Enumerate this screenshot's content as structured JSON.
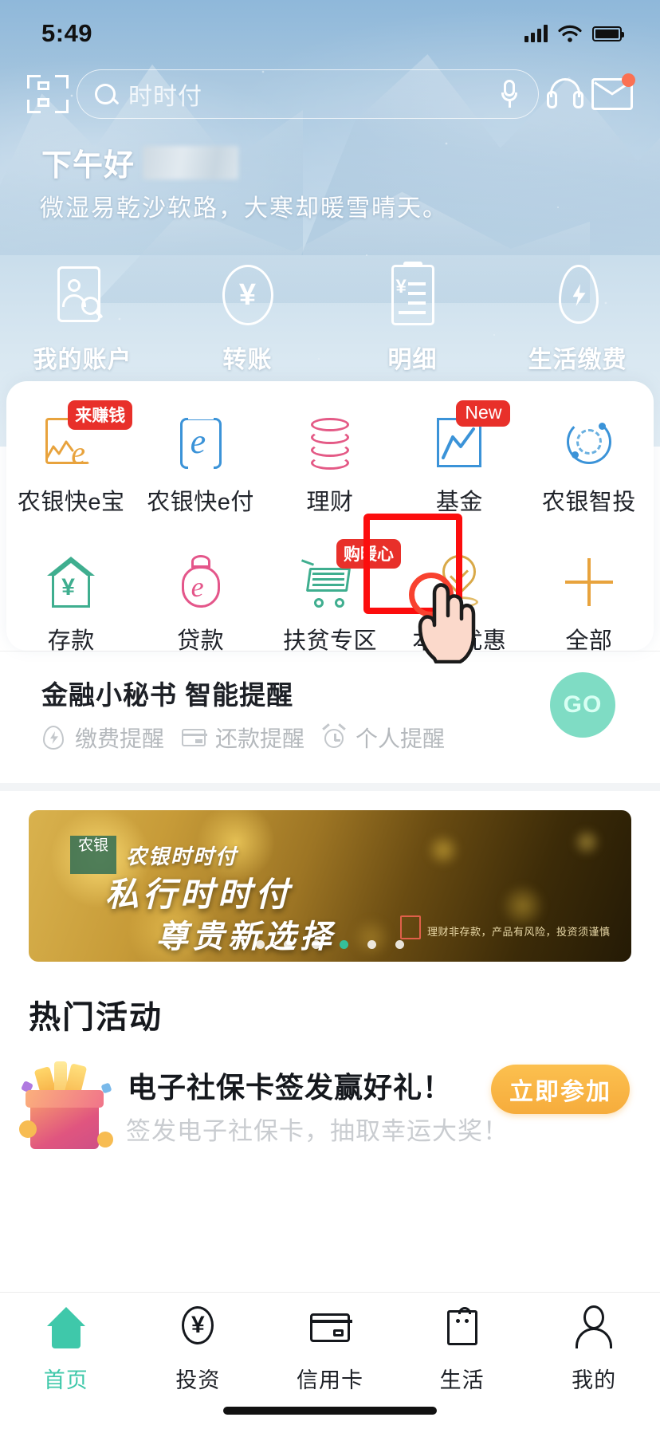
{
  "status_bar": {
    "time": "5:49",
    "signal_icon": "signal-bars-icon",
    "wifi_icon": "wifi-icon",
    "battery_icon": "battery-full-icon"
  },
  "search": {
    "scan_icon": "scan-code-icon",
    "search_icon": "search-icon",
    "query": "时时付",
    "mic_icon": "microphone-icon",
    "headset_icon": "customer-service-headset-icon",
    "mail_icon": "mail-envelope-icon",
    "mail_has_unread": true
  },
  "hero": {
    "greeting": "下午好",
    "username_masked": "",
    "poem": "微湿易乾沙软路，大寒却暖雪晴天。"
  },
  "quick_actions": [
    {
      "label": "我的账户",
      "icon": "account-card-search-icon"
    },
    {
      "label": "转账",
      "icon": "transfer-yuan-icon"
    },
    {
      "label": "明细",
      "icon": "statement-detail-icon"
    },
    {
      "label": "生活缴费",
      "icon": "utility-payment-icon"
    }
  ],
  "grid": {
    "row1": [
      {
        "label": "农银快e宝",
        "icon": "nongyin-kuai-e-bao-icon",
        "badge": "来赚钱",
        "color": "#e8a33d"
      },
      {
        "label": "农银快e付",
        "icon": "nongyin-kuai-e-fu-icon",
        "badge": "",
        "color": "#3b93d8"
      },
      {
        "label": "理财",
        "icon": "wealth-coins-icon",
        "badge": "",
        "color": "#e45a86"
      },
      {
        "label": "基金",
        "icon": "fund-chart-icon",
        "badge": "New",
        "color": "#3b93d8"
      },
      {
        "label": "农银智投",
        "icon": "smart-invest-icon",
        "badge": "",
        "color": "#3b93d8"
      }
    ],
    "row2": [
      {
        "label": "存款",
        "icon": "deposit-house-icon",
        "badge": "",
        "color": "#3fae8f"
      },
      {
        "label": "贷款",
        "icon": "loan-moneybag-icon",
        "badge": "",
        "color": "#e4568a"
      },
      {
        "label": "扶贫专区",
        "icon": "poverty-alleviation-cart-icon",
        "badge": "购暖心",
        "color": "#3fae8f"
      },
      {
        "label": "本地优惠",
        "icon": "local-offers-pin-icon",
        "badge": "",
        "color": "#d9a948"
      },
      {
        "label": "全部",
        "icon": "all-plus-icon",
        "badge": "",
        "color": "#e8a33d"
      }
    ]
  },
  "highlight": {
    "target_label": "本地优惠",
    "box_color": "#fc0d0d",
    "cursor_icon": "hand-pointer-cursor",
    "tap_ripple_color": "#f8422f"
  },
  "assistant": {
    "title": "金融小秘书 智能提醒",
    "items": [
      {
        "label": "缴费提醒",
        "icon": "utility-drop-icon"
      },
      {
        "label": "还款提醒",
        "icon": "credit-card-icon"
      },
      {
        "label": "个人提醒",
        "icon": "alarm-clock-icon"
      }
    ],
    "go_label": "GO",
    "go_color": "#7fdcc4"
  },
  "banner": {
    "logo_text": "农银",
    "kicker": "农银时时付",
    "line1": "私行时时付",
    "line2": "尊贵新选择",
    "fine_print": "理财非存款，产品有风险，投资须谨慎",
    "dots_total": 6,
    "dots_active_index": 3,
    "dot_active_color": "#35bf9a"
  },
  "hot_section": {
    "title": "热门活动",
    "promo": {
      "icon": "gift-box-icon",
      "title": "电子社保卡签发赢好礼！",
      "subtitle": "签发电子社保卡，抽取幸运大奖！",
      "button_label": "立即参加",
      "button_color": "#f6ac3c"
    }
  },
  "tabbar": {
    "active_index": 0,
    "active_color": "#3fc8aa",
    "items": [
      {
        "label": "首页",
        "icon": "home-icon"
      },
      {
        "label": "投资",
        "icon": "invest-yuan-icon"
      },
      {
        "label": "信用卡",
        "icon": "credit-card-icon"
      },
      {
        "label": "生活",
        "icon": "life-bag-icon"
      },
      {
        "label": "我的",
        "icon": "profile-person-icon"
      }
    ]
  },
  "symbols": {
    "yuan": "¥",
    "yang": "¥",
    "e": "e"
  }
}
